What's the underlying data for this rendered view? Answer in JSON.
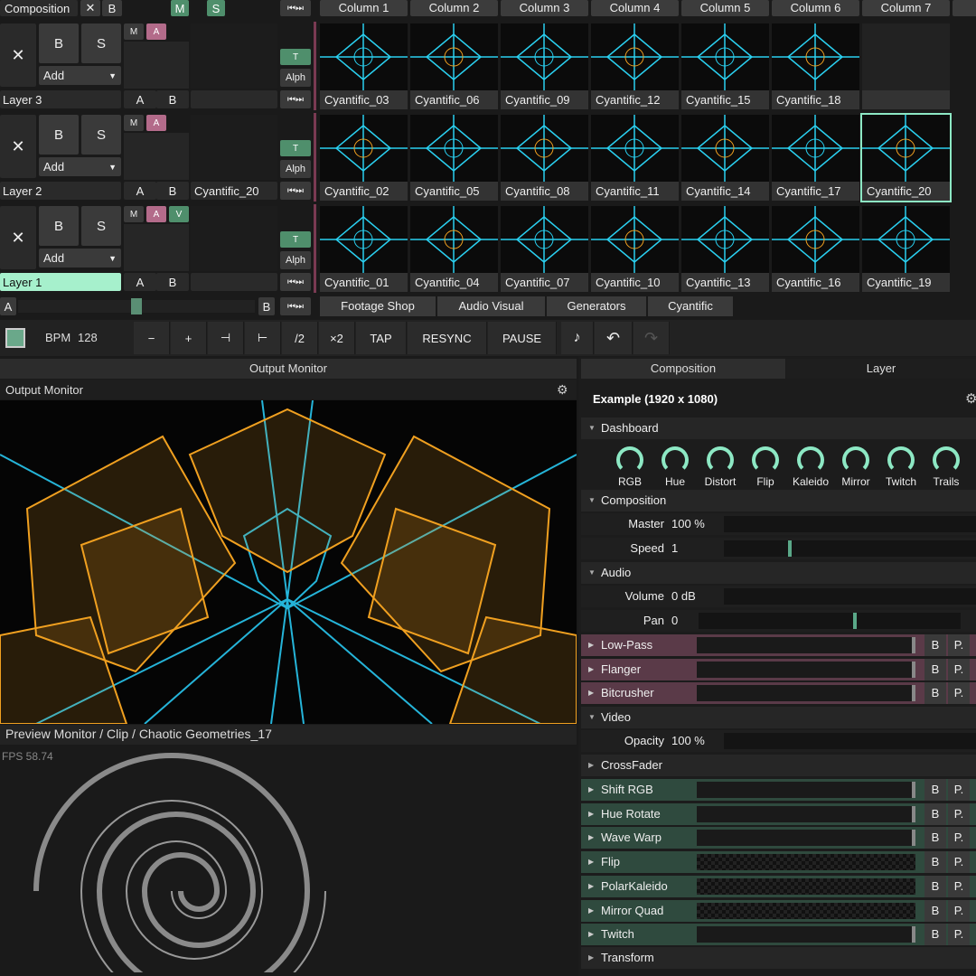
{
  "top": {
    "composition_label": "Composition",
    "x_label": "✕",
    "b_label": "B",
    "m_label": "M",
    "s_label": "S"
  },
  "columns": [
    "Column 1",
    "Column 2",
    "Column 3",
    "Column 4",
    "Column 5",
    "Column 6",
    "Column 7"
  ],
  "layers": [
    {
      "name": "Layer 3",
      "add": "Add",
      "clip_name": "",
      "clips": [
        "Cyantific_03",
        "Cyantific_06",
        "Cyantific_09",
        "Cyantific_12",
        "Cyantific_15",
        "Cyantific_18",
        ""
      ]
    },
    {
      "name": "Layer 2",
      "add": "Add",
      "clip_name": "Cyantific_20",
      "clips": [
        "Cyantific_02",
        "Cyantific_05",
        "Cyantific_08",
        "Cyantific_11",
        "Cyantific_14",
        "Cyantific_17",
        "Cyantific_20"
      ]
    },
    {
      "name": "Layer 1",
      "add": "Add",
      "clip_name": "",
      "clips": [
        "Cyantific_01",
        "Cyantific_04",
        "Cyantific_07",
        "Cyantific_10",
        "Cyantific_13",
        "Cyantific_16",
        "Cyantific_19"
      ]
    }
  ],
  "layer_ctrl": {
    "b": "B",
    "s": "S",
    "m": "M",
    "a": "A",
    "v": "V",
    "t": "T",
    "alph": "Alph",
    "x": "✕"
  },
  "crossfader": {
    "a": "A",
    "b": "B"
  },
  "deck_tabs": [
    "Footage Shop",
    "Audio Visual",
    "Generators",
    "Cyantific"
  ],
  "toolbar": {
    "bpm_label": "BPM",
    "bpm_value": "128",
    "minus": "−",
    "plus": "+",
    "half": "/2",
    "double": "×2",
    "tap": "TAP",
    "resync": "RESYNC",
    "pause": "PAUSE"
  },
  "output": {
    "panel_title": "Output Monitor",
    "header": "Output Monitor"
  },
  "preview": {
    "header": "Preview Monitor / Clip / Chaotic Geometries_17",
    "fps": "FPS 58.74"
  },
  "right": {
    "tab_comp": "Composition",
    "tab_layer": "Layer",
    "title": "Example (1920 x 1080)",
    "dashboard": "Dashboard",
    "knobs": [
      "RGB",
      "Hue",
      "Distort",
      "Flip",
      "Kaleido",
      "Mirror",
      "Twitch",
      "Trails"
    ],
    "composition": "Composition",
    "master_label": "Master",
    "master_value": "100 %",
    "speed_label": "Speed",
    "speed_value": "1",
    "audio": "Audio",
    "volume_label": "Volume",
    "volume_value": "0 dB",
    "pan_label": "Pan",
    "pan_value": "0",
    "audio_fx": [
      "Low-Pass",
      "Flanger",
      "Bitcrusher"
    ],
    "video": "Video",
    "opacity_label": "Opacity",
    "opacity_value": "100 %",
    "crossfader": "CrossFader",
    "video_fx": [
      "Shift RGB",
      "Hue Rotate",
      "Wave Warp",
      "Flip",
      "PolarKaleido",
      "Mirror Quad",
      "Twitch"
    ],
    "transform": "Transform",
    "b": "B",
    "p": "P."
  },
  "colors": {
    "accent": "#8de8c4",
    "pink": "#b36b8a",
    "green": "#4f8f6c",
    "cyan": "#2ad0f0",
    "orange": "#f0a020"
  }
}
